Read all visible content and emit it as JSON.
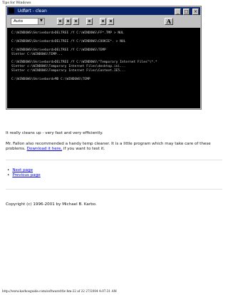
{
  "browser": {
    "header": "Tips for Windows",
    "footer": "http://www.karbosguide.com/software/tfw-hm-22 af 22 27/2004 4:07:31 AM"
  },
  "dos_window": {
    "title": "Udført - clean",
    "font_setting": "Auto",
    "font_button": "A",
    "console_text": "C:\\WINDOWS\\Skrivebord>DELTREE /Y C:\\WINDOWS\\FF*.TMP > NUL\n\nC:\\WINDOWS\\Skrivebord>DELTREE /Y C:\\WINDOWS\\COOKIE*. > NUL\n\nC:\\WINDOWS\\Skrivebord>DELTREE /Y C:\\WINDOWS\\TEMP\nSletter C:\\WINDOWS\\TEMP...\n\nC:\\WINDOWS\\Skrivebord>DELTREE /Y C:\\WINDOWS\\\"Temporary Internet Files\"\\*.*\nSletter c:\\WINDOWS\\Temporary Internet Files\\desktop.ini...\nSletter c:\\WINDOWS\\Temporary Internet Files\\Content.IE5...\n\nC:\\WINDOWS\\Skrivebord>MD C:\\WINDOWS\\TEMP"
  },
  "content": {
    "paragraph1": "It really cleans up - very fast and very efficiently.",
    "paragraph2_text": "Mr. Fallon also recommended a handy temp cleaner. It is a little program which may take care of these problems.",
    "paragraph2_link": "Download it here,",
    "paragraph2_suffix": " if you want to test it."
  },
  "nav": {
    "items": [
      {
        "label": "Next page"
      },
      {
        "label": "Previous page"
      }
    ]
  },
  "copyright": "Copyright (c) 1996-2001 by Michael B. Karbo."
}
